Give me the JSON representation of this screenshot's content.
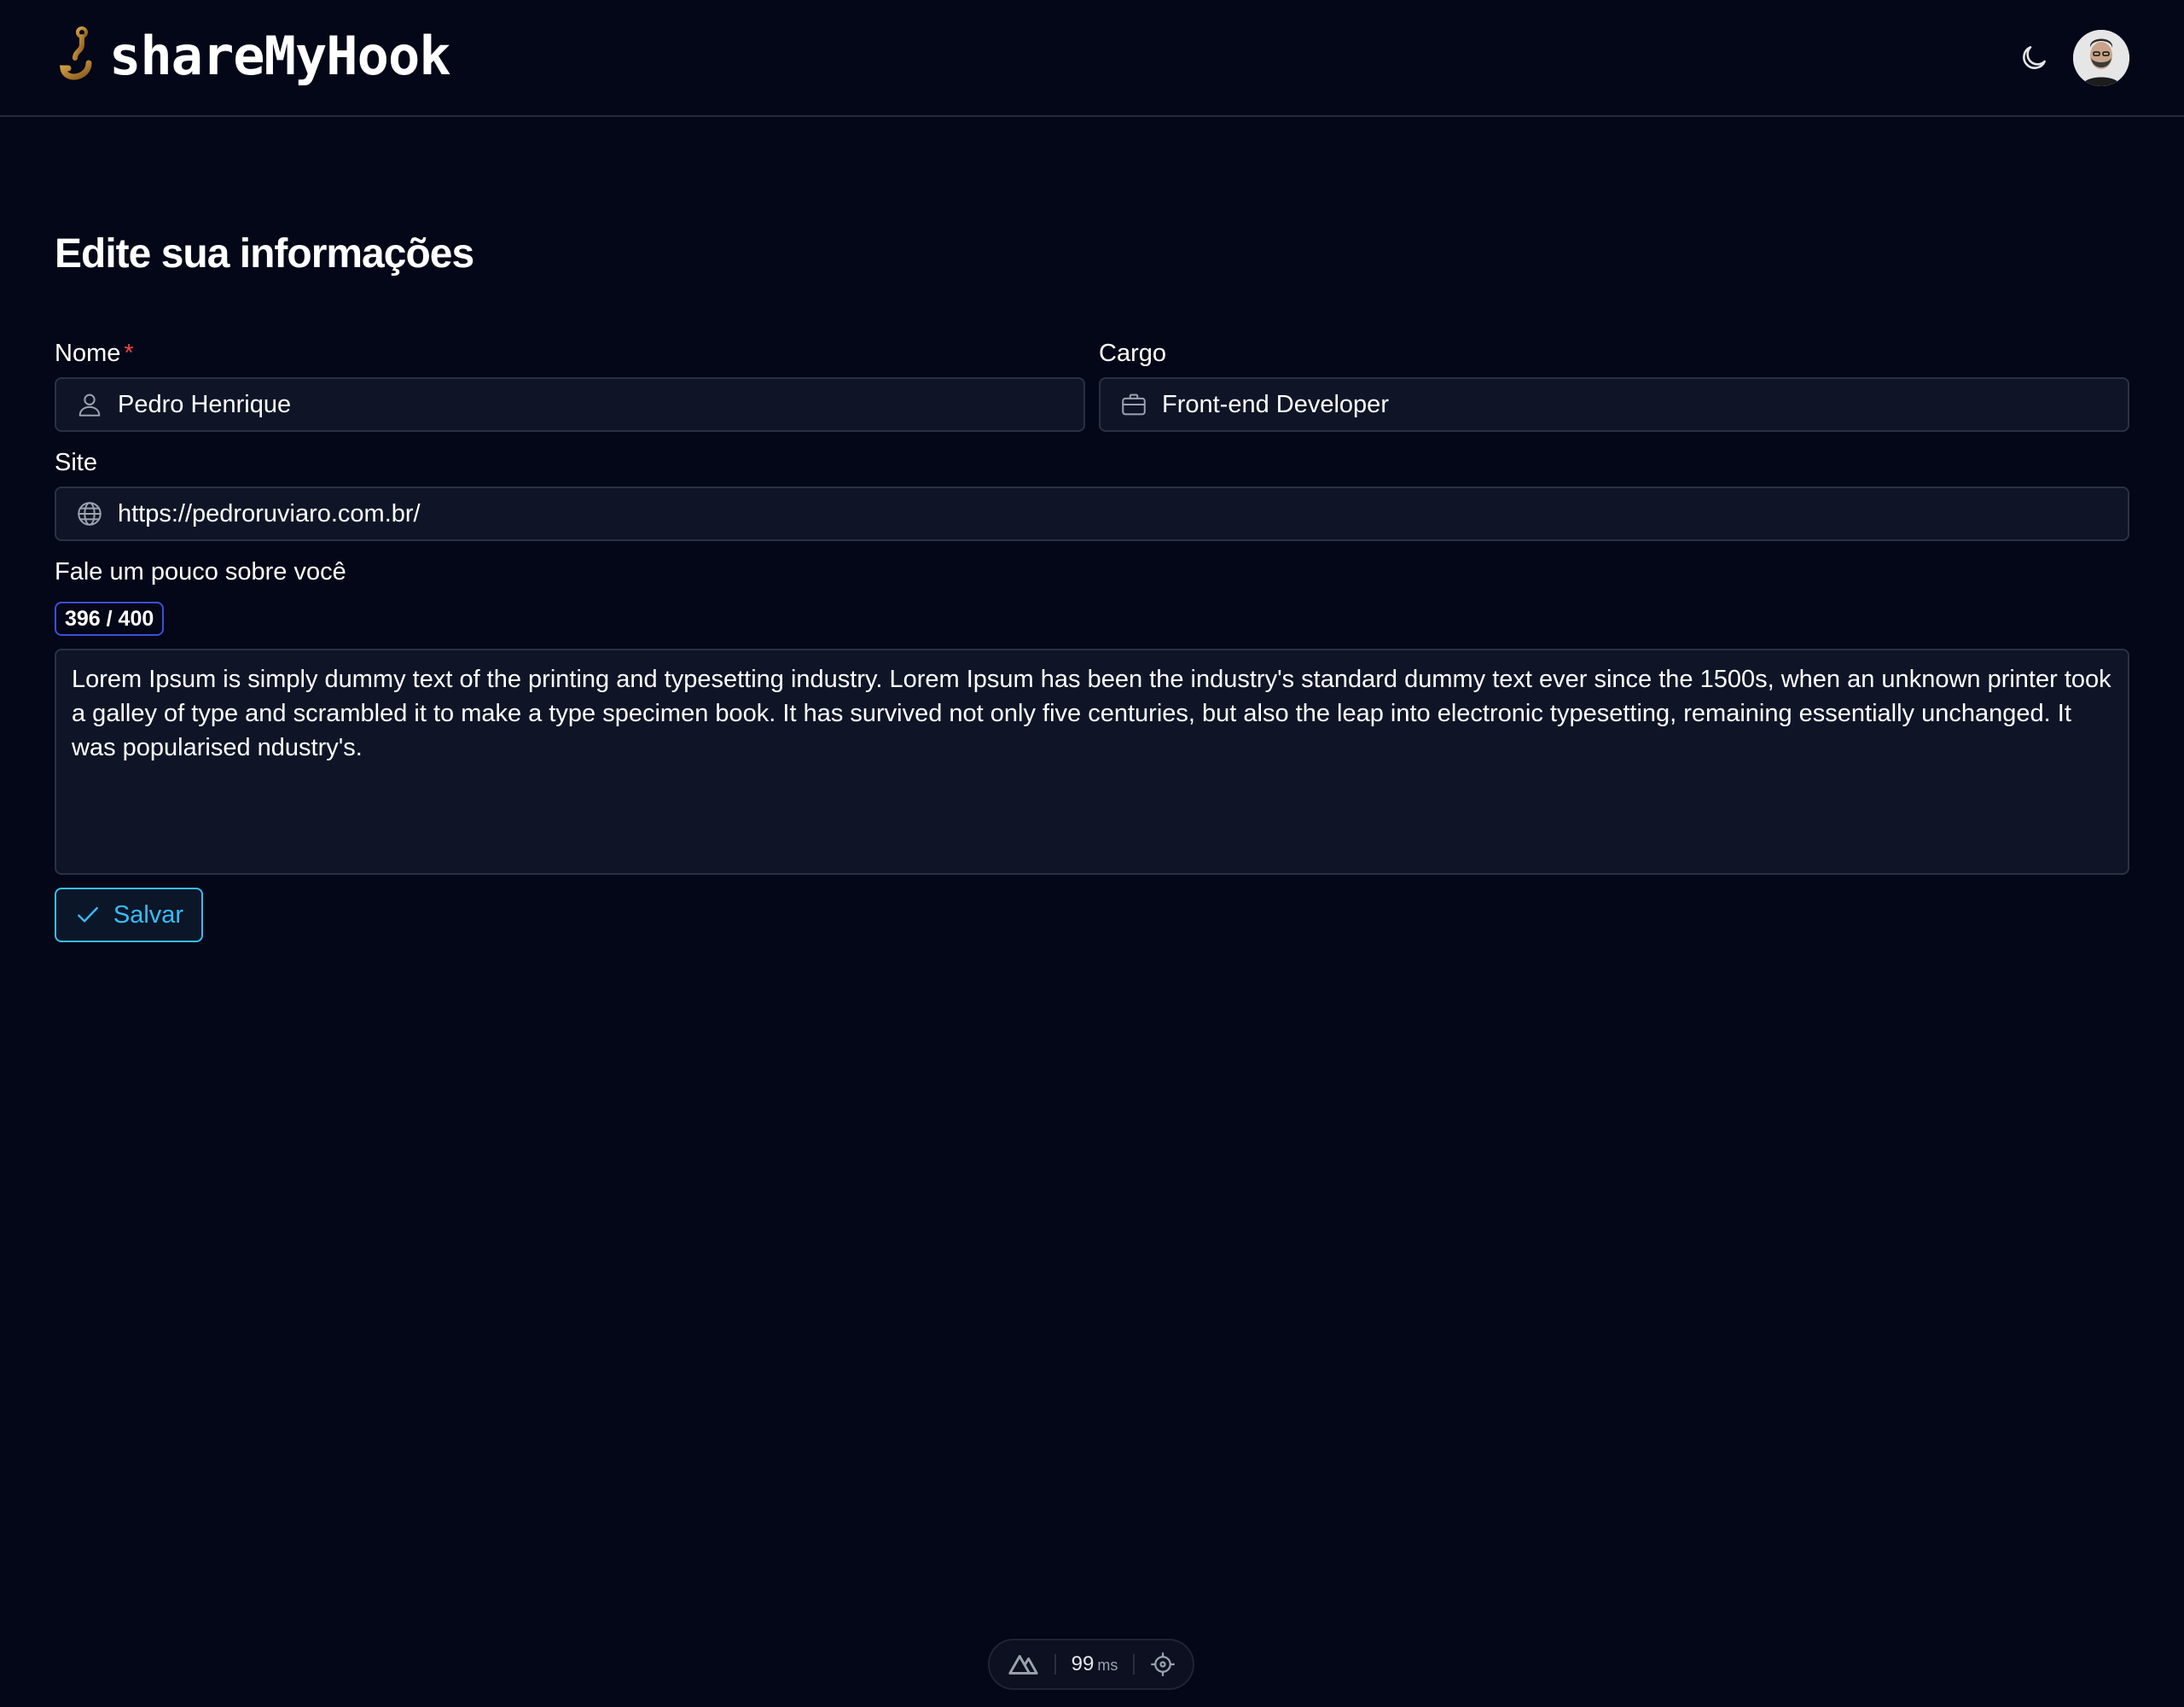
{
  "header": {
    "logo_text": "shareMyHook",
    "logo_icon": "hook-icon",
    "theme_icon": "moon-icon",
    "avatar_alt": "user avatar"
  },
  "page": {
    "title": "Edite sua informações"
  },
  "form": {
    "name": {
      "label": "Nome",
      "required_mark": "*",
      "value": "Pedro Henrique",
      "icon": "user-icon"
    },
    "role": {
      "label": "Cargo",
      "value": "Front-end Developer",
      "icon": "briefcase-icon"
    },
    "site": {
      "label": "Site",
      "value": "https://pedroruviaro.com.br/",
      "icon": "globe-icon"
    },
    "about": {
      "label": "Fale um pouco sobre você",
      "counter": "396 / 400",
      "value": "Lorem Ipsum is simply dummy text of the printing and typesetting industry. Lorem Ipsum has been the industry's standard dummy text ever since the 1500s, when an unknown printer took a galley of type and scrambled it to make a type specimen book. It has survived not only five centuries, but also the leap into electronic typesetting, remaining essentially unchanged. It was popularised ndustry's."
    },
    "save_label": "Salvar"
  },
  "dev_badge": {
    "time_value": "99",
    "time_unit": "ms"
  },
  "colors": {
    "background": "#030717",
    "input_bg": "#0f1527",
    "accent": "#38bdf8",
    "required": "#ef4444",
    "counter_border": "#3b4fd8"
  }
}
